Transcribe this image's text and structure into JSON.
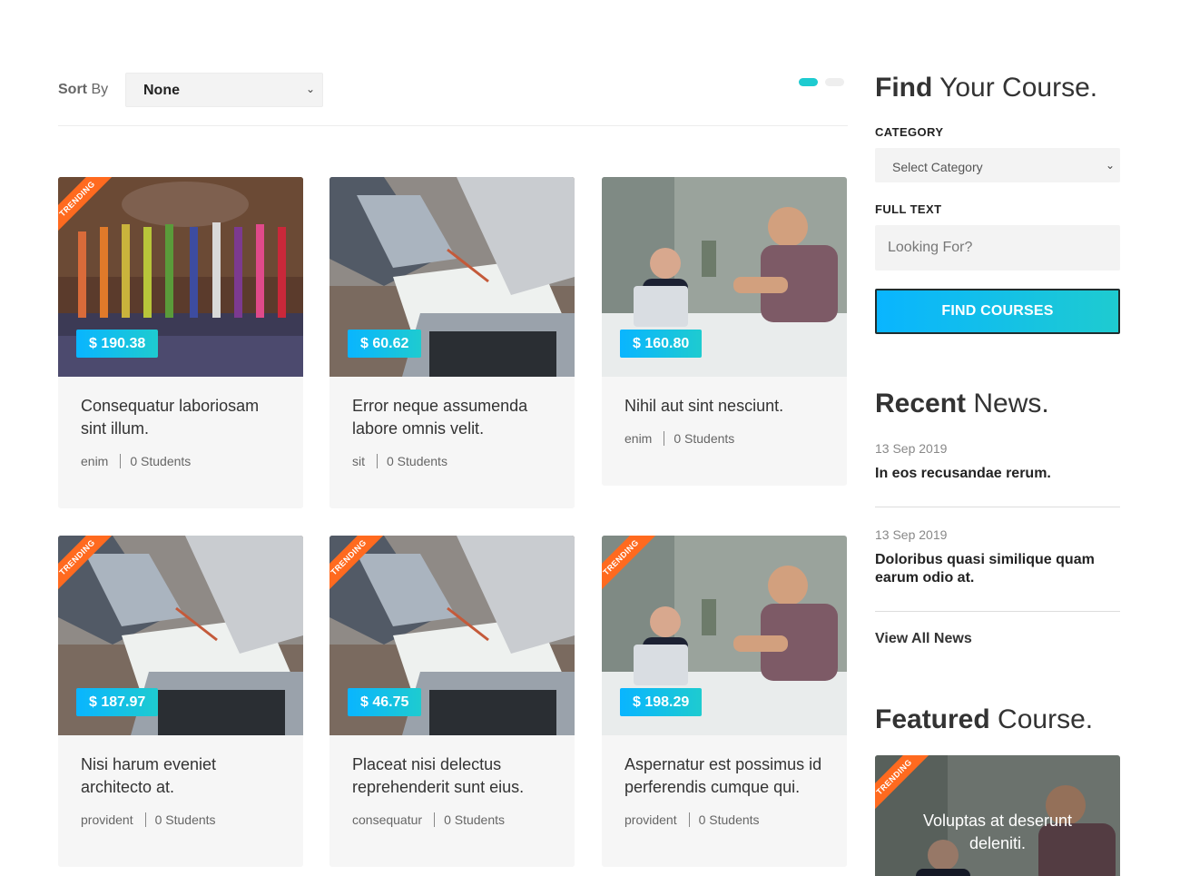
{
  "toolbar": {
    "sort_label_bold": "Sort",
    "sort_label_rest": "By",
    "sort_value": "None"
  },
  "courses": [
    {
      "title": "Consequatur laboriosam sint illum.",
      "price": "$ 190.38",
      "category": "enim",
      "students": "0 Students",
      "trending": true,
      "image": "crayons"
    },
    {
      "title": "Error neque assumenda labore omnis velit.",
      "price": "$ 60.62",
      "category": "sit",
      "students": "0 Students",
      "trending": false,
      "image": "laptop-desk"
    },
    {
      "title": "Nihil aut sint nesciunt.",
      "price": "$ 160.80",
      "category": "enim",
      "students": "0 Students",
      "trending": false,
      "image": "tutoring"
    },
    {
      "title": "Nisi harum eveniet architecto at.",
      "price": "$ 187.97",
      "category": "provident",
      "students": "0 Students",
      "trending": true,
      "image": "laptop-desk"
    },
    {
      "title": "Placeat nisi delectus reprehenderit sunt eius.",
      "price": "$ 46.75",
      "category": "consequatur",
      "students": "0 Students",
      "trending": true,
      "image": "laptop-desk"
    },
    {
      "title": "Aspernatur est possimus id perferendis cumque qui.",
      "price": "$ 198.29",
      "category": "provident",
      "students": "0 Students",
      "trending": true,
      "image": "tutoring"
    }
  ],
  "ribbon_text": "TRENDING",
  "sidebar": {
    "find": {
      "heading_bold": "Find",
      "heading_rest": "Your Course.",
      "category_label": "CATEGORY",
      "category_value": "Select Category",
      "fulltext_label": "FULL TEXT",
      "fulltext_placeholder": "Looking For?",
      "button": "FIND COURSES"
    },
    "news": {
      "heading_bold": "Recent",
      "heading_rest": "News.",
      "items": [
        {
          "date": "13 Sep 2019",
          "title": "In eos recusandae rerum."
        },
        {
          "date": "13 Sep 2019",
          "title": "Doloribus quasi similique quam earum odio at."
        }
      ],
      "view_all": "View All News"
    },
    "featured": {
      "heading_bold": "Featured",
      "heading_rest": "Course.",
      "title": "Voluptas at deserunt deleniti."
    }
  },
  "colors": {
    "accent_start": "#09b5ff",
    "accent_end": "#1ecbd0",
    "ribbon": "#ff6a1f"
  }
}
